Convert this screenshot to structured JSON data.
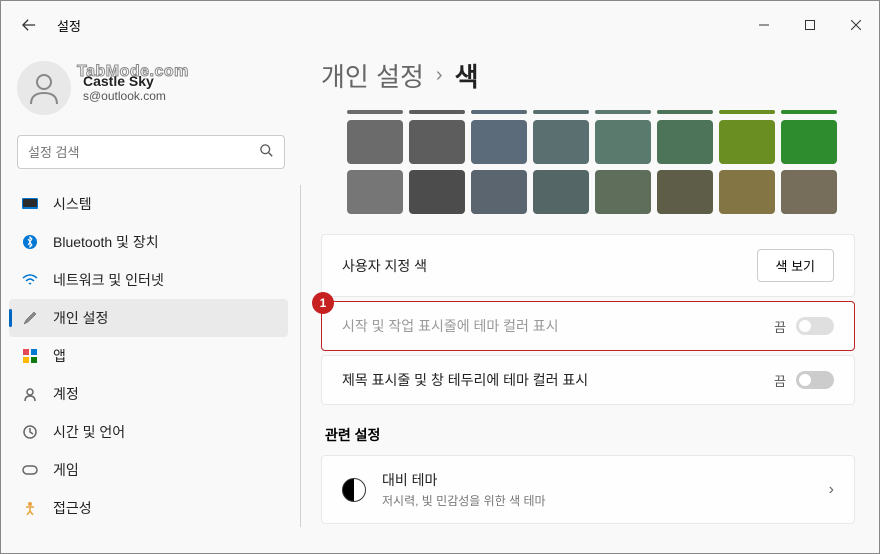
{
  "window": {
    "title": "설정"
  },
  "profile": {
    "watermark": "TabMode.com",
    "name": "Castle Sky",
    "email": "s@outlook.com"
  },
  "search": {
    "placeholder": "설정 검색"
  },
  "nav": {
    "system": "시스템",
    "bluetooth": "Bluetooth 및 장치",
    "network": "네트워크 및 인터넷",
    "personalization": "개인 설정",
    "apps": "앱",
    "accounts": "계정",
    "time": "시간 및 언어",
    "gaming": "게임",
    "accessibility": "접근성"
  },
  "breadcrumb": {
    "parent": "개인 설정",
    "current": "색"
  },
  "colors": {
    "row1": [
      "#6b6b6b",
      "#5d5d5d",
      "#5c6b7a",
      "#5a7070",
      "#5a7a6e",
      "#4d7358",
      "#6b8e23",
      "#2e8b2e"
    ],
    "row2": [
      "#767676",
      "#4c4c4c",
      "#5a6570",
      "#556666",
      "#5e6e5b",
      "#5d5d48",
      "#847545",
      "#766d5a"
    ]
  },
  "settings": {
    "custom_color_label": "사용자 지정 색",
    "view_color_btn": "색 보기",
    "start_taskbar_label": "시작 및 작업 표시줄에 테마 컬러 표시",
    "titlebar_label": "제목 표시줄 및 창 테두리에 테마 컬러 표시",
    "toggle_off": "끔",
    "badge_num": "1"
  },
  "related": {
    "section_title": "관련 설정",
    "contrast_title": "대비 테마",
    "contrast_desc": "저시력, 빛 민감성을 위한 색 테마"
  }
}
